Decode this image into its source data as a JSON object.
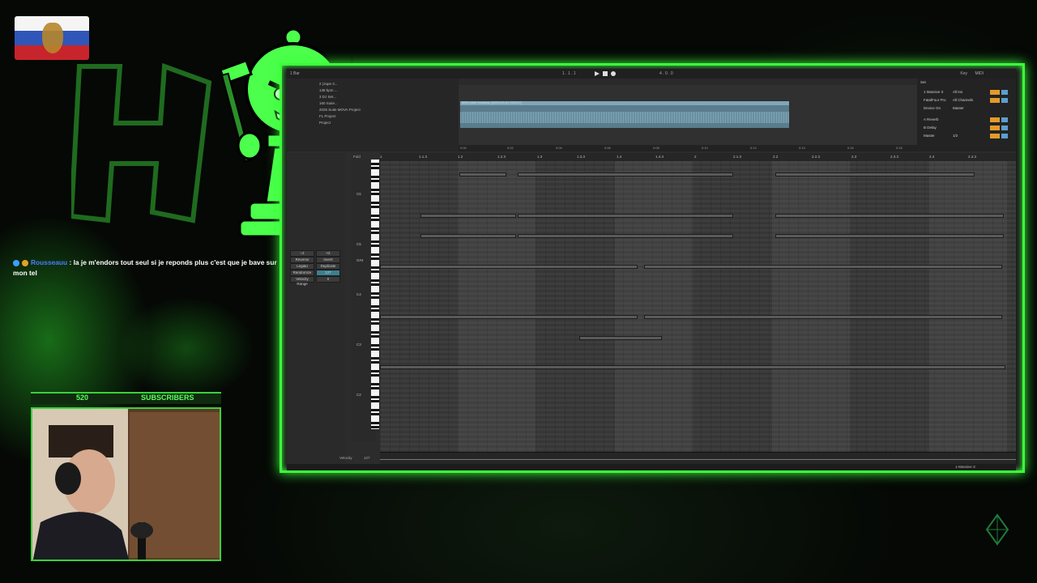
{
  "stream": {
    "subscribers_count": "520",
    "subscribers_label": "SUBSCRIBERS",
    "chat": {
      "user": "Rousseauu",
      "message": " : la je m'endors tout seul si je reponds plus c'est que je bave sur mon tel"
    }
  },
  "colors": {
    "accent": "#3cff3c",
    "clip": "#5a7c8c",
    "mixer_orange": "#e39a2a",
    "user_blue": "#4a7fff"
  },
  "daw": {
    "tempo": "1 Bar",
    "position": "1 . 1 . 1",
    "loop_length": "4 . 0 . 0",
    "key_label": "Key",
    "midi_label": "MIDI",
    "browser_items": [
      "2 (Jupe 3...",
      "138 bpm ...",
      "3 DJ Set...",
      "160 Suite...",
      "2025 Suite MOVA Project",
      "FL Project",
      "Project"
    ],
    "clip_name": "MIDI piste rousseau [2026-03-01 020137]",
    "arrangement_ticks": [
      "1",
      "2",
      "3",
      "4",
      "5",
      "6",
      "7",
      "8",
      "9",
      "10",
      "11"
    ],
    "time_marks": [
      "0:00",
      "0:02",
      "0:04",
      "0:06",
      "0:08",
      "0:10",
      "0:12",
      "0:14",
      "0:16",
      "0:18"
    ],
    "set_label": "Set",
    "mixer": [
      {
        "name": "1 Massive X",
        "route": "All Ins"
      },
      {
        "name": "FatalFour Pro",
        "route": "All Channels"
      },
      {
        "name": "Device On",
        "route": "Master"
      },
      {
        "name": "A Reverb",
        "route": ""
      },
      {
        "name": "B Delay",
        "route": ""
      },
      {
        "name": "Master",
        "route": "1/2"
      }
    ],
    "left_panel": {
      "fold": "Fold",
      "reverse": "Reverse",
      "invert": "Invert",
      "legato": "Legato",
      "duplicate": "Duplicate",
      "randomize": "Randomize",
      "randomize_value": "127",
      "velocity_range": "Velocity Range",
      "velocity_range_value": "0",
      "div2": "÷2",
      "mul2": "×2"
    },
    "roll_ruler": [
      "1",
      "1.1.3",
      "1.2",
      "1.2.3",
      "1.3",
      "1.3.3",
      "1.4",
      "1.4.3",
      "2",
      "2.1.3",
      "2.2",
      "2.2.3",
      "2.3",
      "2.3.3",
      "2.4",
      "2.4.3"
    ],
    "octaves": [
      "C6",
      "C5",
      "G#4",
      "C4",
      "C3",
      "C2"
    ],
    "velocity_label": "Velocity",
    "velocity_value": "127",
    "bottom_track": "1-Massive X"
  }
}
